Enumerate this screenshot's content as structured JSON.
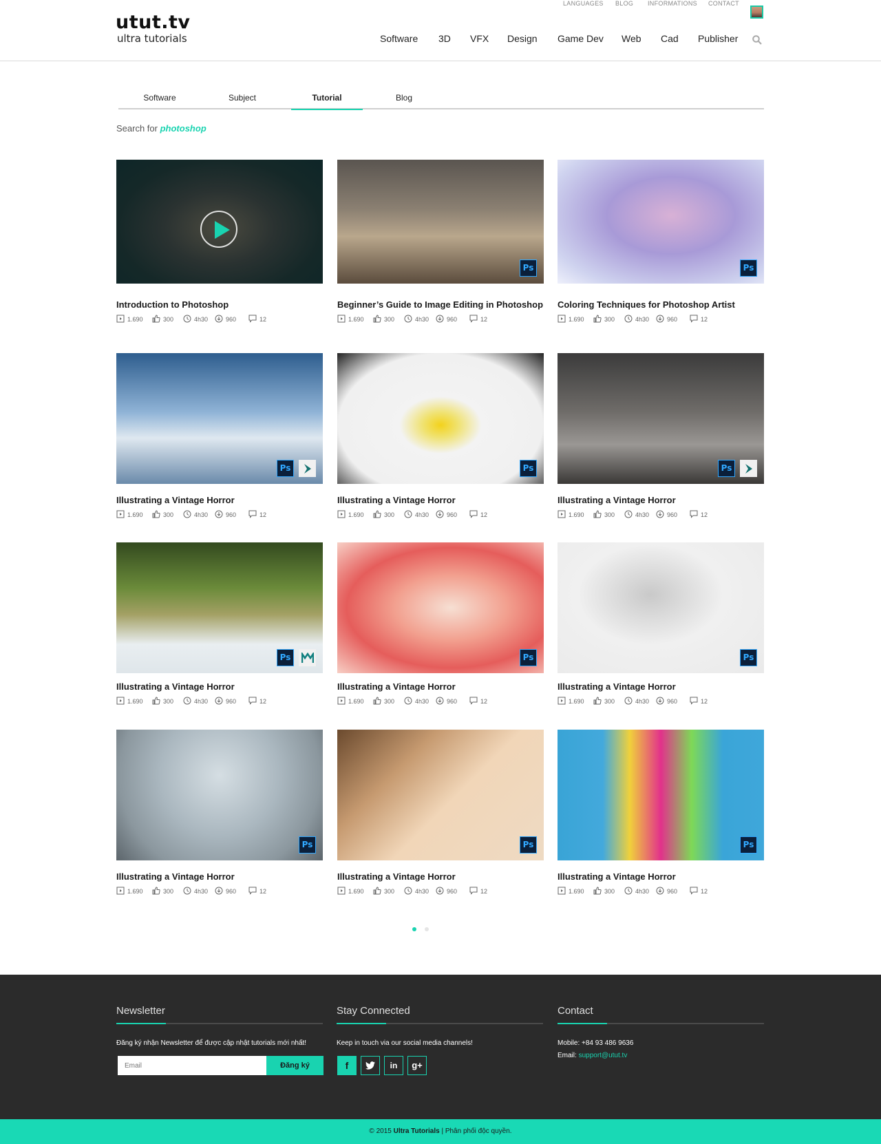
{
  "brand": {
    "name": "utut.tv",
    "tagline": "ultra tutorials"
  },
  "top_links": [
    "LANGUAGES",
    "BLOG",
    "INFORMATIONS",
    "CONTACT"
  ],
  "nav": [
    "Software",
    "3D",
    "VFX",
    "Design",
    "Game Dev",
    "Web",
    "Cad",
    "Publisher"
  ],
  "tabs": [
    "Software",
    "Subject",
    "Tutorial",
    "Blog"
  ],
  "active_tab": "Tutorial",
  "search": {
    "prefix": "Search for",
    "term": "photoshop"
  },
  "stats_default": {
    "views": "1.690",
    "likes": "300",
    "duration": "4h30",
    "downloads": "960",
    "comments": "12"
  },
  "cards": [
    {
      "title": "Introduction to Photoshop",
      "badges": []
    },
    {
      "title": "Beginner’s Guide to Image Editing in Photoshop",
      "badges": [
        "Ps"
      ]
    },
    {
      "title": "Coloring Techniques for Photoshop Artist",
      "badges": [
        "Ps"
      ]
    },
    {
      "title": "Illustrating a Vintage Horror",
      "badges": [
        "Ps",
        "3ds"
      ]
    },
    {
      "title": "Illustrating a Vintage Horror",
      "badges": [
        "Ps"
      ]
    },
    {
      "title": "Illustrating a Vintage Horror",
      "badges": [
        "Ps",
        "3ds"
      ]
    },
    {
      "title": "Illustrating a Vintage Horror",
      "badges": [
        "Ps",
        "Maya"
      ]
    },
    {
      "title": "Illustrating a Vintage Horror",
      "badges": [
        "Ps"
      ]
    },
    {
      "title": "Illustrating a Vintage Horror",
      "badges": [
        "Ps"
      ]
    },
    {
      "title": "Illustrating a Vintage Horror",
      "badges": [
        "Ps"
      ]
    },
    {
      "title": "Illustrating a Vintage Horror",
      "badges": [
        "Ps"
      ]
    },
    {
      "title": "Illustrating a Vintage Horror",
      "badges": [
        "Ps"
      ]
    }
  ],
  "footer": {
    "newsletter": {
      "title": "Newsletter",
      "text": "Đăng ký nhận Newsletter để được cập nhật tutorials mới nhất!",
      "placeholder": "Email",
      "button": "Đăng ký"
    },
    "social": {
      "title": "Stay Connected",
      "text": "Keep in touch via our social media channels!",
      "icons": [
        "f",
        "twitter-icon",
        "in",
        "g+"
      ]
    },
    "contact": {
      "title": "Contact",
      "mobile_label": "Mobile:",
      "mobile": "+84 93 486 9636",
      "email_label": "Email:",
      "email": "support@utut.tv"
    }
  },
  "copyright": {
    "prefix": "© 2015",
    "brand": "Ultra Tutorials",
    "suffix": "| Phân phối độc quyền."
  },
  "colors": {
    "accent": "#19d3b0",
    "footer_bg": "#2b2b2b",
    "ps_badge": "#31a8ff"
  }
}
